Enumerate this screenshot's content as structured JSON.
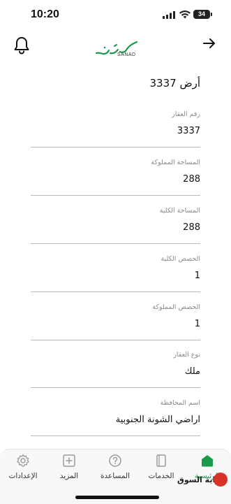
{
  "status_bar": {
    "time": "10:20",
    "battery": "34"
  },
  "header": {
    "logo_text": "SANAD"
  },
  "land_title": "أرض 3337",
  "fields": [
    {
      "label": "رقم العقار",
      "value": "3337"
    },
    {
      "label": "المساحة المملوكة",
      "value": "288"
    },
    {
      "label": "المساحة الكلية",
      "value": "288"
    },
    {
      "label": "الحصص الكلية",
      "value": "1"
    },
    {
      "label": "الحصص المملوكة",
      "value": "1"
    },
    {
      "label": "نوع العقار",
      "value": "ملك"
    },
    {
      "label": "اسم المحافظة",
      "value": "اراضي الشونة الجنوبية"
    }
  ],
  "tabbar": {
    "items": [
      {
        "label": "الإعدادات",
        "icon": "gear-icon"
      },
      {
        "label": "المزيد",
        "icon": "plus-square-icon"
      },
      {
        "label": "المساعدة",
        "icon": "help-circle-icon"
      },
      {
        "label": "الخدمات",
        "icon": "document-icon"
      },
      {
        "label": "الرئيسية",
        "icon": "home-icon",
        "active": true
      }
    ]
  },
  "watermark": {
    "text": "بوابة السوق"
  },
  "colors": {
    "brand_green": "#1a9a4b",
    "divider": "#b8b8b8",
    "label_gray": "#8a8a8a"
  }
}
